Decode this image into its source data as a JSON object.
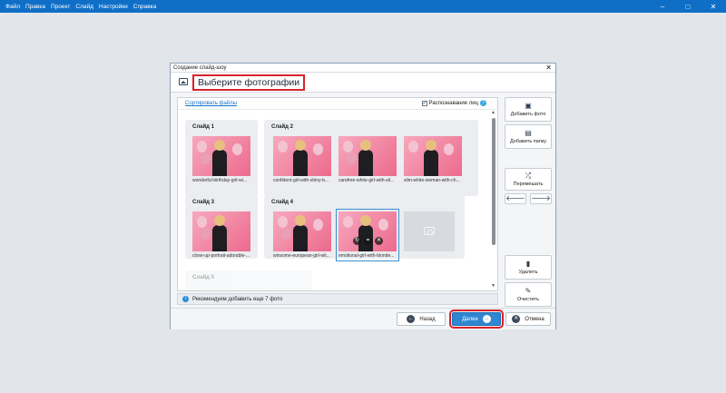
{
  "menu": {
    "items": [
      "Файл",
      "Правка",
      "Проект",
      "Слайд",
      "Настройки",
      "Справка"
    ]
  },
  "window_controls": {
    "minimize": "–",
    "maximize": "□",
    "close": "✕"
  },
  "dialog": {
    "title": "Создание слайд-шоу",
    "close": "✕",
    "heading": "Выберите фотографии",
    "sort_link": "Сортировать файлы",
    "face_recognition": {
      "label": "Распознавание лиц",
      "checked": true,
      "check": "✓",
      "help": "?"
    },
    "slides": [
      {
        "label": "Слайд 1",
        "photos": [
          "wonderful-birthday-girl-wi..."
        ]
      },
      {
        "label": "Слайд 2",
        "photos": [
          "confident-girl-with-shiny-b...",
          "carefree-white-girl-with-sil...",
          "slim-white-woman-with-ch..."
        ]
      },
      {
        "label": "Слайд 3",
        "photos": [
          "close-up-portrait-adorable-..."
        ]
      },
      {
        "label": "Слайд 4",
        "photos": [
          "winsome-european-girl-wit...",
          "emotional-girl-with-blonde..."
        ]
      },
      {
        "label": "Слайд 5",
        "photos": []
      }
    ],
    "photo_actions": {
      "rotate": "↻",
      "crop": "⌗",
      "delete": "✕"
    },
    "info": {
      "icon": "i",
      "text": "Рекомендуем добавить еще 7 фото"
    },
    "side_buttons": {
      "add_photo": {
        "label": "Добавить фото",
        "icon": "image-icon",
        "glyph": "▣"
      },
      "add_folder": {
        "label": "Добавить папку",
        "icon": "folder-icon",
        "glyph": "▤"
      },
      "shuffle": {
        "label": "Перемешать",
        "icon": "shuffle-icon",
        "glyph": "⤮"
      },
      "move_left": {
        "glyph": "🡐"
      },
      "move_right": {
        "glyph": "🡒"
      },
      "delete": {
        "label": "Удалить",
        "icon": "trash-icon",
        "glyph": "▮"
      },
      "clear": {
        "label": "Очистить",
        "icon": "broom-icon",
        "glyph": "✎"
      }
    },
    "scroll": {
      "up": "▲",
      "down": "▼"
    },
    "footer": {
      "back": {
        "label": "Назад",
        "glyph": "←"
      },
      "next": {
        "label": "Далее",
        "glyph": "→"
      },
      "cancel": {
        "label": "Отмена",
        "glyph": "✕"
      }
    }
  },
  "colors": {
    "accent": "#0f6fc6",
    "highlight": "#d8232a",
    "primary_button": "#2f86d1"
  }
}
